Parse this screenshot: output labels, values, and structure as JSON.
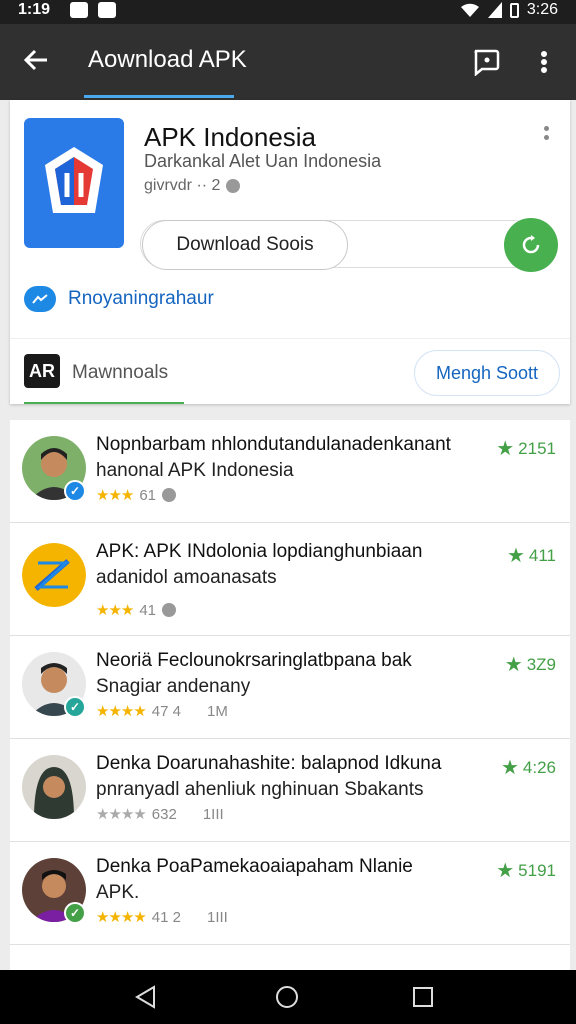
{
  "status": {
    "time": "1:19",
    "clock_right": "3:26"
  },
  "app_bar": {
    "title": "Aownload APK"
  },
  "app": {
    "name": "APK Indonesia",
    "subtitle": "Darkankal Alet Uan Indonesia",
    "version": "givrvdr ·· 2",
    "download_label": "Download Soois",
    "developer": "Rnoyaningrahaur",
    "downloads_badge": "AR",
    "downloads_label": "Mawnnoals",
    "search_sort_label": "Mengh Soott"
  },
  "items": [
    {
      "title": "Nopnbarbam nhlondutandulanadenkanant",
      "subtitle": "hanonal APK Indonesia",
      "stars": "★★★",
      "meta": "61",
      "extra": "",
      "score": "2151",
      "badge_color": "#1e88e5",
      "starred": true
    },
    {
      "title": "APK: APK INdolonia lopdianghunbiaan",
      "subtitle": "adanidol amoanasats",
      "stars": "★★★",
      "meta": "41",
      "extra": "",
      "score": "411",
      "badge_color": "",
      "starred": true
    },
    {
      "title": "Neoriä Feclounokrsaringlatbpana bak",
      "subtitle": "Snagiar andenany",
      "stars": "★★★★",
      "meta": "47 4",
      "extra": "1M",
      "score": "3Z9",
      "badge_color": "#26a69a",
      "starred": true
    },
    {
      "title": "Denka Doarunahashite: balapnod Idkuna",
      "subtitle": "pnranyadl ahenliuk nghinuan Sbakants",
      "stars": "★★★★",
      "meta": "632",
      "extra": "1III",
      "score": "4:26",
      "badge_color": "",
      "starred": false
    },
    {
      "title": "Denka PoaPamekaoaiapaham Nlanie",
      "subtitle": "APK.",
      "stars": "★★★★",
      "meta": "41 2",
      "extra": "1III",
      "score": "5191",
      "badge_color": "#43a047",
      "starred": true
    }
  ],
  "colors": {
    "accent": "#49b050",
    "primary": "#2a7ae8",
    "appbar": "#303030"
  }
}
